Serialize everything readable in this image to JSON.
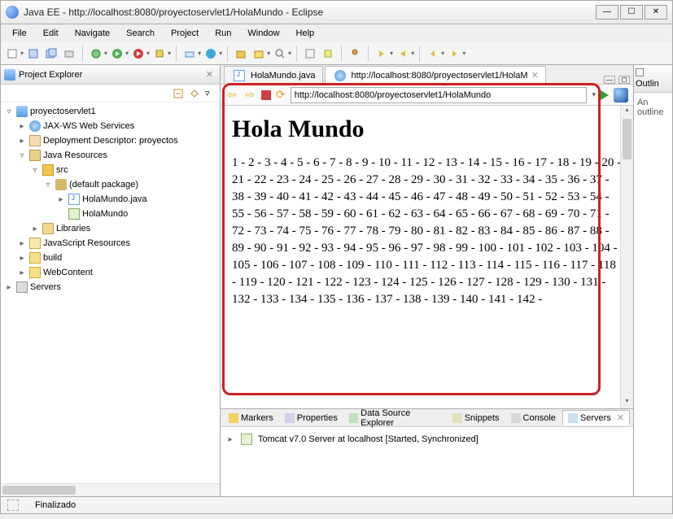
{
  "window": {
    "title": "Java EE - http://localhost:8080/proyectoservlet1/HolaMundo - Eclipse"
  },
  "menu": {
    "items": [
      "File",
      "Edit",
      "Navigate",
      "Search",
      "Project",
      "Run",
      "Window",
      "Help"
    ]
  },
  "project_explorer": {
    "title": "Project Explorer",
    "tree": {
      "project": "proyectoservlet1",
      "jaxws": "JAX-WS Web Services",
      "dd": "Deployment Descriptor: proyectos",
      "javares": "Java Resources",
      "src": "src",
      "defpkg": "(default package)",
      "javafile": "HolaMundo.java",
      "servlet": "HolaMundo",
      "libs": "Libraries",
      "jsres": "JavaScript Resources",
      "build": "build",
      "webcontent": "WebContent",
      "servers": "Servers"
    }
  },
  "editor": {
    "tab1": "HolaMundo.java",
    "tab2": "http://localhost:8080/proyectoservlet1/HolaM",
    "url": "http://localhost:8080/proyectoservlet1/HolaMundo"
  },
  "page": {
    "heading": "Hola Mundo",
    "numbers": "1 - 2 - 3 - 4 - 5 - 6 - 7 - 8 - 9 - 10 - 11 - 12 - 13 - 14 - 15 - 16 - 17 - 18 - 19 - 20 - 21 - 22 - 23 - 24 - 25 - 26 - 27 - 28 - 29 - 30 - 31 - 32 - 33 - 34 - 35 - 36 - 37 - 38 - 39 - 40 - 41 - 42 - 43 - 44 - 45 - 46 - 47 - 48 - 49 - 50 - 51 - 52 - 53 - 54 - 55 - 56 - 57 - 58 - 59 - 60 - 61 - 62 - 63 - 64 - 65 - 66 - 67 - 68 - 69 - 70 - 71 - 72 - 73 - 74 - 75 - 76 - 77 - 78 - 79 - 80 - 81 - 82 - 83 - 84 - 85 - 86 - 87 - 88 - 89 - 90 - 91 - 92 - 93 - 94 - 95 - 96 - 97 - 98 - 99 - 100 - 101 - 102 - 103 - 104 - 105 - 106 - 107 - 108 - 109 - 110 - 111 - 112 - 113 - 114 - 115 - 116 - 117 - 118 - 119 - 120 - 121 - 122 - 123 - 124 - 125 - 126 - 127 - 128 - 129 - 130 - 131 - 132 - 133 - 134 - 135 - 136 - 137 - 138 - 139 - 140 - 141 - 142 -"
  },
  "outline": {
    "title": "Outlin",
    "body": "An outline"
  },
  "bottom_tabs": {
    "markers": "Markers",
    "properties": "Properties",
    "dse": "Data Source Explorer",
    "snippets": "Snippets",
    "console": "Console",
    "servers": "Servers"
  },
  "server": {
    "row": "Tomcat v7.0 Server at localhost  [Started, Synchronized]"
  },
  "status": {
    "text": "Finalizado"
  }
}
